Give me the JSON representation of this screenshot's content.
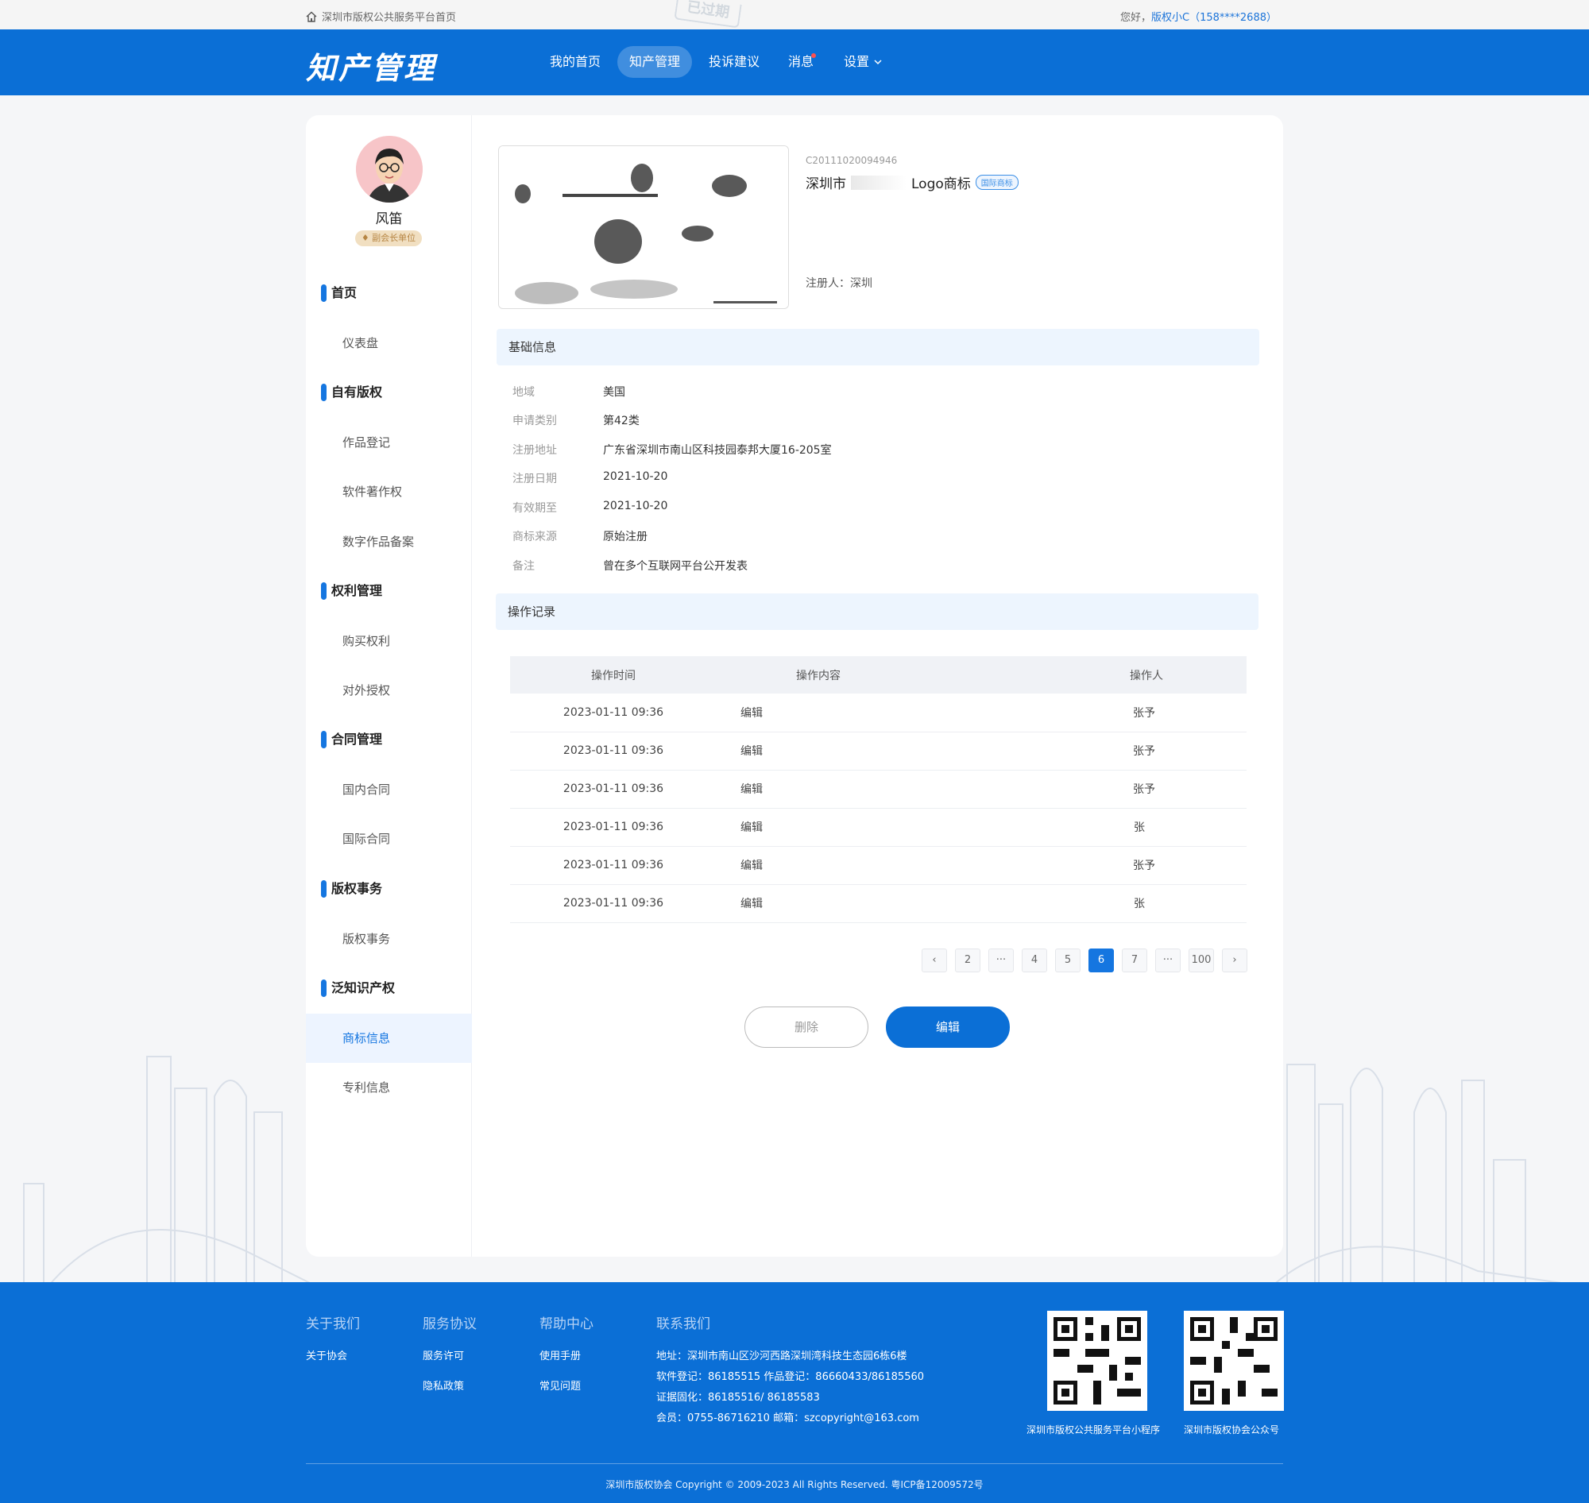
{
  "topbar": {
    "home_link": "深圳市版权公共服务平台首页",
    "greeting_prefix": "您好，",
    "user_link": "版权小C（158****2688）",
    "stamp": "已过期"
  },
  "nav": {
    "logo": "知产管理",
    "items": [
      {
        "label": "我的首页"
      },
      {
        "label": "知产管理"
      },
      {
        "label": "投诉建议"
      },
      {
        "label": "消息"
      },
      {
        "label": "设置"
      }
    ]
  },
  "user": {
    "name": "风笛",
    "badge": "副会长单位"
  },
  "sidebar": {
    "groups": [
      {
        "label": "首页",
        "items": [
          "仪表盘"
        ]
      },
      {
        "label": "自有版权",
        "items": [
          "作品登记",
          "软件著作权",
          "数字作品备案"
        ]
      },
      {
        "label": "权利管理",
        "items": [
          "购买权利",
          "对外授权"
        ]
      },
      {
        "label": "合同管理",
        "items": [
          "国内合同",
          "国际合同"
        ]
      },
      {
        "label": "版权事务",
        "items": [
          "版权事务"
        ]
      },
      {
        "label": "泛知识产权",
        "items": [
          "商标信息",
          "专利信息"
        ]
      }
    ],
    "active": "商标信息"
  },
  "trademark": {
    "code": "C20111020094946",
    "name_prefix": "深圳市",
    "name_suffix": "Logo商标",
    "tag": "国际商标",
    "registrant_label": "注册人：",
    "registrant_value": "深圳"
  },
  "basic": {
    "title": "基础信息",
    "rows": [
      {
        "k": "地域",
        "v": "美国"
      },
      {
        "k": "申请类别",
        "v": "第42类"
      },
      {
        "k": "注册地址",
        "v": "广东省深圳市南山区科技园泰邦大厦16-205室"
      },
      {
        "k": "注册日期",
        "v": "2021-10-20"
      },
      {
        "k": "有效期至",
        "v": "2021-10-20"
      },
      {
        "k": "商标来源",
        "v": "原始注册"
      },
      {
        "k": "备注",
        "v": "曾在多个互联网平台公开发表"
      }
    ]
  },
  "records": {
    "title": "操作记录",
    "headers": [
      "操作时间",
      "操作内容",
      "操作人"
    ],
    "rows": [
      {
        "time": "2023-01-11 09:36",
        "content": "编辑",
        "operator": "张予"
      },
      {
        "time": "2023-01-11 09:36",
        "content": "编辑",
        "operator": "张予"
      },
      {
        "time": "2023-01-11 09:36",
        "content": "编辑",
        "operator": "张予"
      },
      {
        "time": "2023-01-11 09:36",
        "content": "编辑",
        "operator": "张"
      },
      {
        "time": "2023-01-11 09:36",
        "content": "编辑",
        "operator": "张予"
      },
      {
        "time": "2023-01-11 09:36",
        "content": "编辑",
        "operator": "张"
      }
    ]
  },
  "pagination": {
    "prev": "‹",
    "next": "›",
    "pages": [
      "2",
      "···",
      "4",
      "5",
      "6",
      "7",
      "···",
      "100"
    ],
    "current": "6"
  },
  "actions": {
    "delete": "删除",
    "edit": "编辑"
  },
  "footer": {
    "cols": [
      {
        "title": "关于我们",
        "links": [
          "关于协会"
        ]
      },
      {
        "title": "服务协议",
        "links": [
          "服务许可",
          "隐私政策"
        ]
      },
      {
        "title": "帮助中心",
        "links": [
          "使用手册",
          "常见问题"
        ]
      },
      {
        "title": "联系我们",
        "links": [
          "地址：深圳市南山区沙河西路深圳湾科技生态园6栋6楼",
          "软件登记：86185515  作品登记：86660433/86185560",
          "证据固化：86185516/ 86185583",
          "会员：0755-86716210  邮箱：szcopyright@163.com"
        ]
      }
    ],
    "qr_captions": [
      "深圳市版权公共服务平台小程序",
      "深圳市版权协会公众号"
    ],
    "copyright": "深圳市版权协会 Copyright © 2009-2023 All Rights Reserved.    粤ICP备12009572号"
  },
  "colors": {
    "primary": "#0b6fd6",
    "accent": "#1576e0",
    "panel": "#edf5fe"
  },
  "icons": {
    "home": "house-icon",
    "settings_arrow": "chevron-down-icon"
  }
}
